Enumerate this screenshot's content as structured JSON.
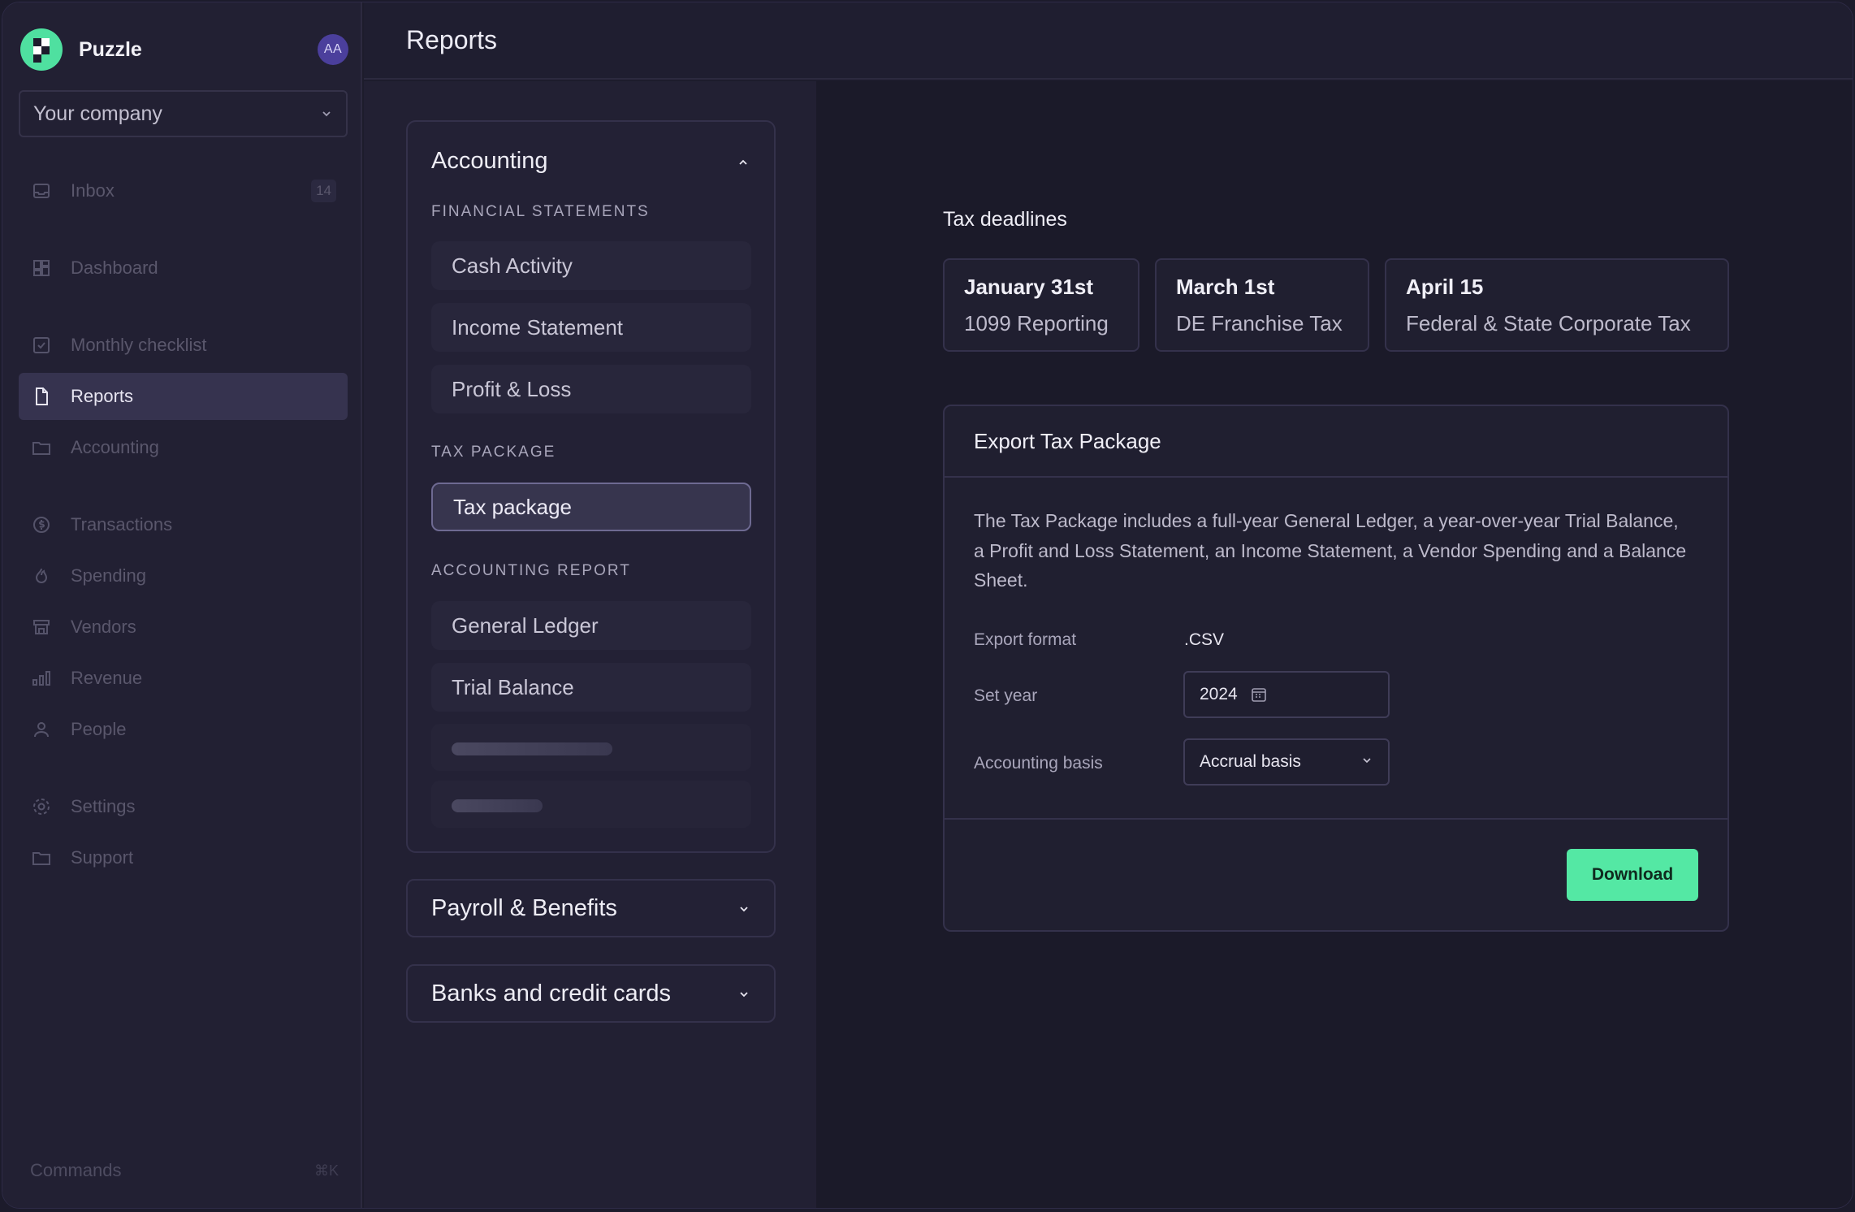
{
  "app": {
    "name": "Puzzle",
    "avatar_initials": "AA"
  },
  "sidebar": {
    "company": "Your company",
    "items": [
      {
        "label": "Inbox",
        "icon": "inbox-icon",
        "badge": "14"
      },
      {
        "label": "Dashboard",
        "icon": "dashboard-icon"
      },
      {
        "label": "Monthly checklist",
        "icon": "checklist-icon"
      },
      {
        "label": "Reports",
        "icon": "file-icon",
        "active": true
      },
      {
        "label": "Accounting",
        "icon": "folder-icon"
      },
      {
        "label": "Transactions",
        "icon": "dollar-cycle-icon"
      },
      {
        "label": "Spending",
        "icon": "flame-icon"
      },
      {
        "label": "Vendors",
        "icon": "store-icon"
      },
      {
        "label": "Revenue",
        "icon": "bar-chart-icon"
      },
      {
        "label": "People",
        "icon": "person-icon"
      },
      {
        "label": "Settings",
        "icon": "gear-icon"
      },
      {
        "label": "Support",
        "icon": "folder-icon"
      }
    ],
    "commands": {
      "label": "Commands",
      "shortcut": "⌘K"
    }
  },
  "header": {
    "title": "Reports"
  },
  "reports_nav": {
    "accounting": {
      "title": "Accounting",
      "sections": [
        {
          "label": "FINANCIAL STATEMENTS",
          "items": [
            "Cash Activity",
            "Income Statement",
            "Profit & Loss"
          ]
        },
        {
          "label": "TAX PACKAGE",
          "items": [
            "Tax package"
          ],
          "selected": "Tax package"
        },
        {
          "label": "ACCOUNTING REPORT",
          "items": [
            "General Ledger",
            "Trial Balance"
          ]
        }
      ]
    },
    "payroll": {
      "title": "Payroll & Benefits"
    },
    "banks": {
      "title": "Banks and credit cards"
    }
  },
  "tax_deadlines": {
    "label": "Tax deadlines",
    "items": [
      {
        "date": "January 31st",
        "title": "1099 Reporting"
      },
      {
        "date": "March 1st",
        "title": "DE Franchise Tax"
      },
      {
        "date": "April 15",
        "title": "Federal & State Corporate Tax"
      }
    ]
  },
  "export_package": {
    "title": "Export Tax Package",
    "description": "The Tax Package includes a full-year General Ledger, a year-over-year Trial Balance, a Profit and Loss Statement, an Income Statement, a Vendor Spending and a Balance Sheet.",
    "format_label": "Export format",
    "format_value": ".CSV",
    "year_label": "Set year",
    "year_value": "2024",
    "basis_label": "Accounting basis",
    "basis_value": "Accrual basis",
    "download_label": "Download"
  },
  "colors": {
    "accent": "#54e8a4",
    "background": "#1b1a29",
    "sidebar": "#222033",
    "active_nav": "#36334f"
  }
}
